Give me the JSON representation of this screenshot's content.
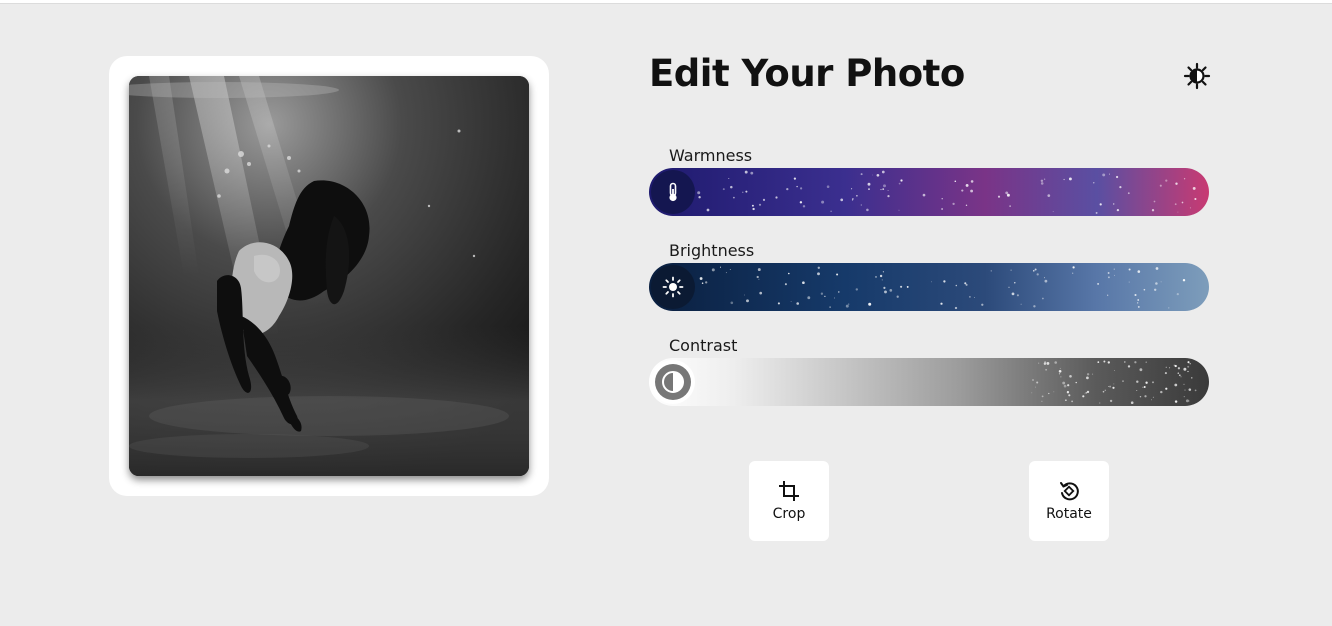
{
  "header": {
    "title": "Edit Your Photo",
    "theme_icon": "sun-half-icon"
  },
  "sliders": [
    {
      "label": "Warmness",
      "icon": "thermometer-icon",
      "value": 0
    },
    {
      "label": "Brightness",
      "icon": "sun-icon",
      "value": 0
    },
    {
      "label": "Contrast",
      "icon": "contrast-icon",
      "value": 0
    }
  ],
  "tools": {
    "crop": {
      "label": "Crop",
      "icon": "crop-icon"
    },
    "rotate": {
      "label": "Rotate",
      "icon": "rotate-icon"
    }
  },
  "colors": {
    "background": "#ececec",
    "card": "#ffffff",
    "warm_start": "#1e1a6e",
    "warm_end": "#c83a72",
    "bright_start": "#0a1f3f",
    "bright_end": "#7d9dbb",
    "contrast_start": "#ffffff",
    "contrast_end": "#3a3a3a"
  }
}
